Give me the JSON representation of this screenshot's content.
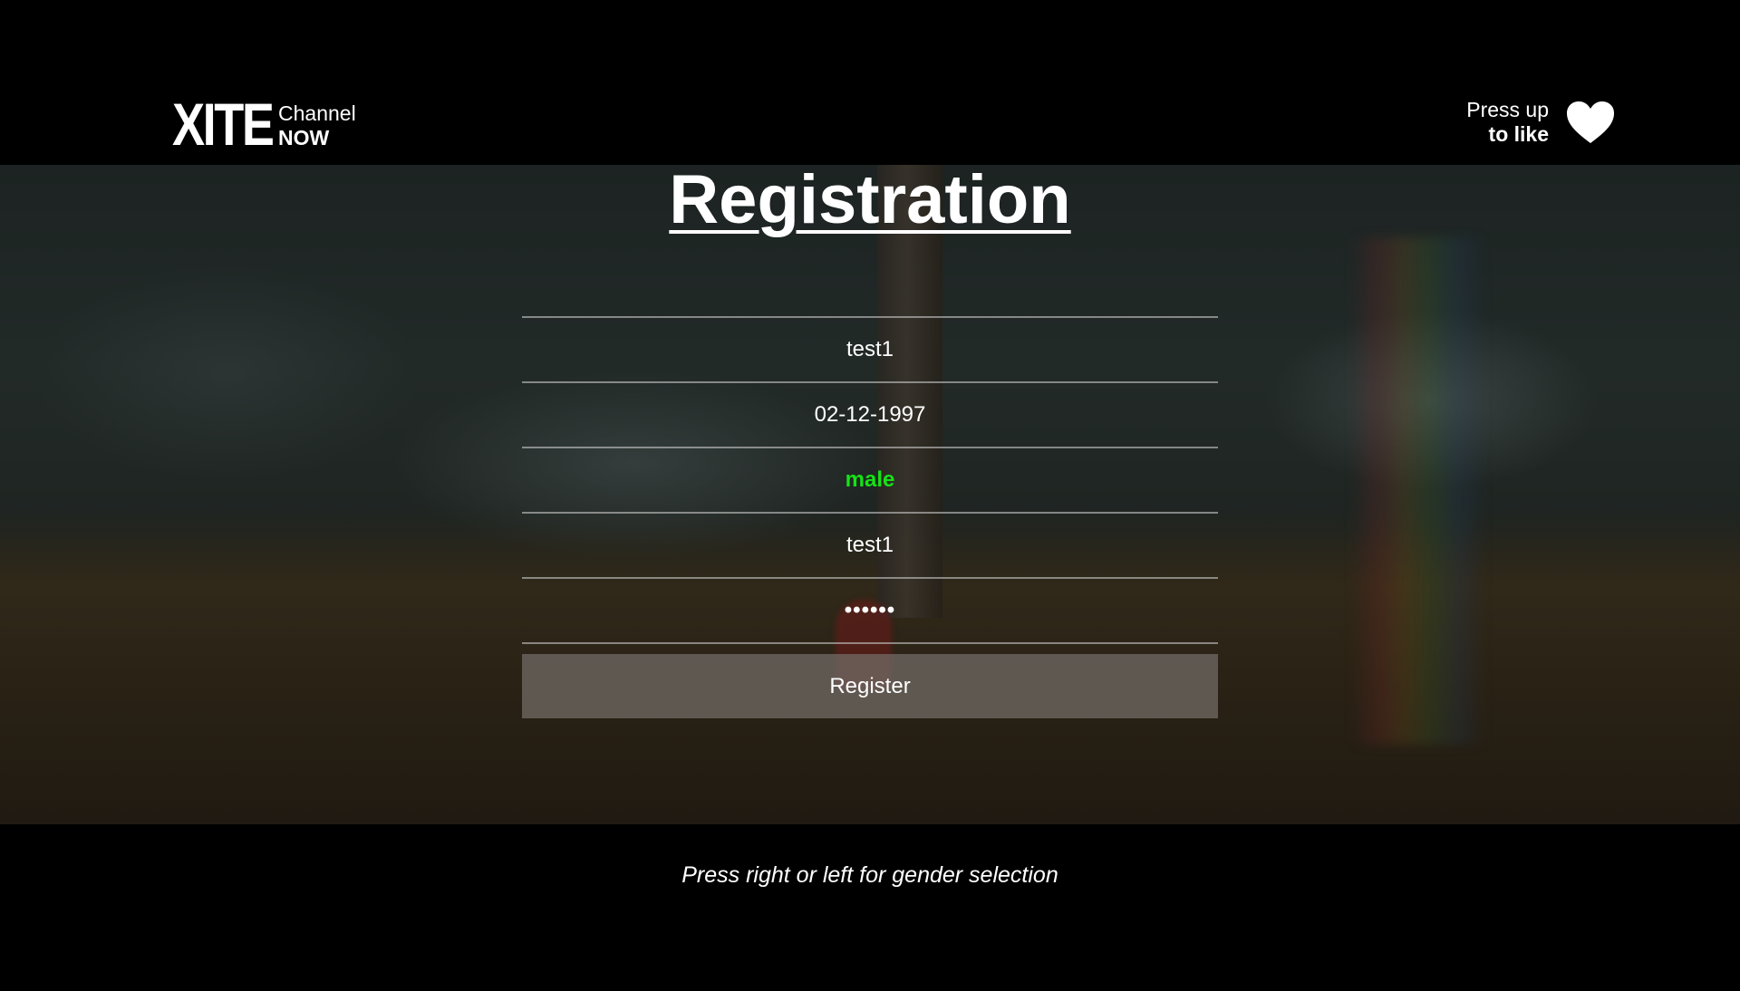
{
  "header": {
    "logo_mark": "XITE",
    "channel_label": "Channel",
    "channel_name": "NOW",
    "like_line1": "Press up",
    "like_line2": "to like",
    "like_icon": "heart-icon"
  },
  "form": {
    "title": "Registration",
    "fields": [
      {
        "name": "username",
        "value": "test1"
      },
      {
        "name": "birthdate",
        "value": "02-12-1997"
      },
      {
        "name": "gender",
        "value": "male"
      },
      {
        "name": "email",
        "value": "test1"
      },
      {
        "name": "password",
        "value": "••••••"
      }
    ],
    "register_label": "Register"
  },
  "hint": "Press right or left for gender selection",
  "colors": {
    "selected_field": "#16e216",
    "background": "#000000",
    "button": "#736e69"
  }
}
